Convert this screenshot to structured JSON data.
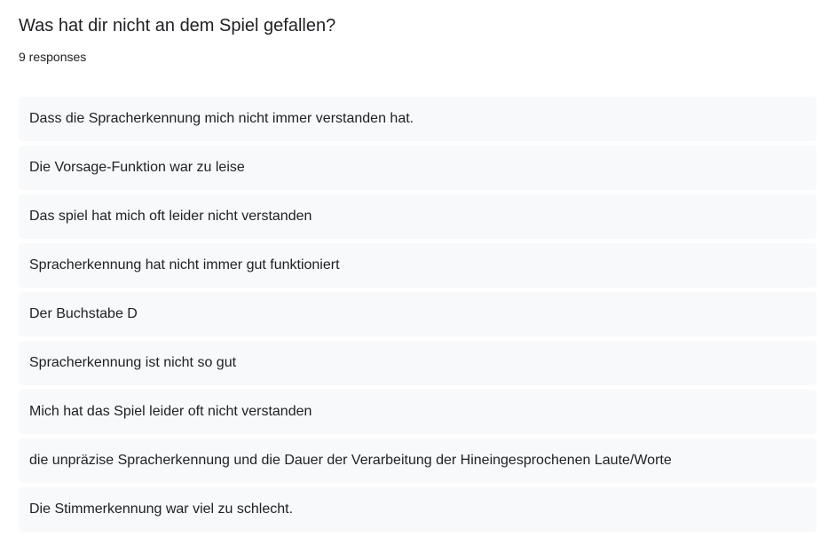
{
  "question": {
    "title": "Was hat dir nicht an dem Spiel gefallen?",
    "response_count": "9 responses"
  },
  "responses": [
    {
      "text": "Dass die Spracherkennung mich nicht immer verstanden hat."
    },
    {
      "text": "Die Vorsage-Funktion war zu leise"
    },
    {
      "text": "Das spiel hat mich oft leider nicht verstanden"
    },
    {
      "text": "Spracherkennung hat nicht immer gut funktioniert"
    },
    {
      "text": "Der Buchstabe D"
    },
    {
      "text": "Spracherkennung ist nicht so gut"
    },
    {
      "text": "Mich hat das Spiel leider oft nicht verstanden"
    },
    {
      "text": "die unpräzise Spracherkennung und die Dauer der Verarbeitung der Hineingesprochenen Laute/Worte"
    },
    {
      "text": "Die Stimmerkennung war viel zu schlecht."
    }
  ],
  "colors": {
    "background": "#ffffff",
    "response_background": "#f8f9fa",
    "text": "#202124"
  }
}
